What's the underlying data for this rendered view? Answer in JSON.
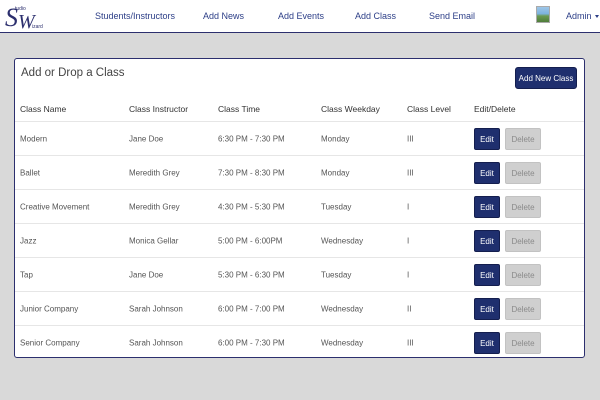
{
  "nav": {
    "logo_text": "Studio Wizard",
    "links": [
      "Students/Instructors",
      "Add News",
      "Add Events",
      "Add Class",
      "Send Email"
    ],
    "admin_label": "Admin"
  },
  "panel": {
    "title": "Add or Drop a Class",
    "add_button": "Add New Class"
  },
  "table": {
    "headers": [
      "Class Name",
      "Class Instructor",
      "Class Time",
      "Class Weekday",
      "Class Level",
      "Edit/Delete"
    ],
    "edit_label": "Edit",
    "delete_label": "Delete",
    "rows": [
      [
        "Modern",
        "Jane Doe",
        "6:30 PM - 7:30 PM",
        "Monday",
        "III"
      ],
      [
        "Ballet",
        "Meredith Grey",
        "7:30 PM - 8:30 PM",
        "Monday",
        "III"
      ],
      [
        "Creative Movement",
        "Meredith Grey",
        "4:30 PM - 5:30 PM",
        "Tuesday",
        "I"
      ],
      [
        "Jazz",
        "Monica Gellar",
        "5:00 PM - 6:00PM",
        "Wednesday",
        "I"
      ],
      [
        "Tap",
        "Jane Doe",
        "5:30 PM - 6:30 PM",
        "Tuesday",
        "I"
      ],
      [
        "Junior Company",
        "Sarah Johnson",
        "6:00 PM - 7:00 PM",
        "Wednesday",
        "II"
      ],
      [
        "Senior Company",
        "Sarah Johnson",
        "6:00 PM - 7:30 PM",
        "Wednesday",
        "III"
      ]
    ]
  },
  "colors": {
    "accent": "#1f2f6e",
    "nav_text": "#2c3e87",
    "background": "#d9d9d9",
    "delete_bg": "#cfcfcf"
  },
  "icons": [
    "studio-wizard-logo-icon",
    "avatar-icon",
    "caret-down-icon"
  ]
}
